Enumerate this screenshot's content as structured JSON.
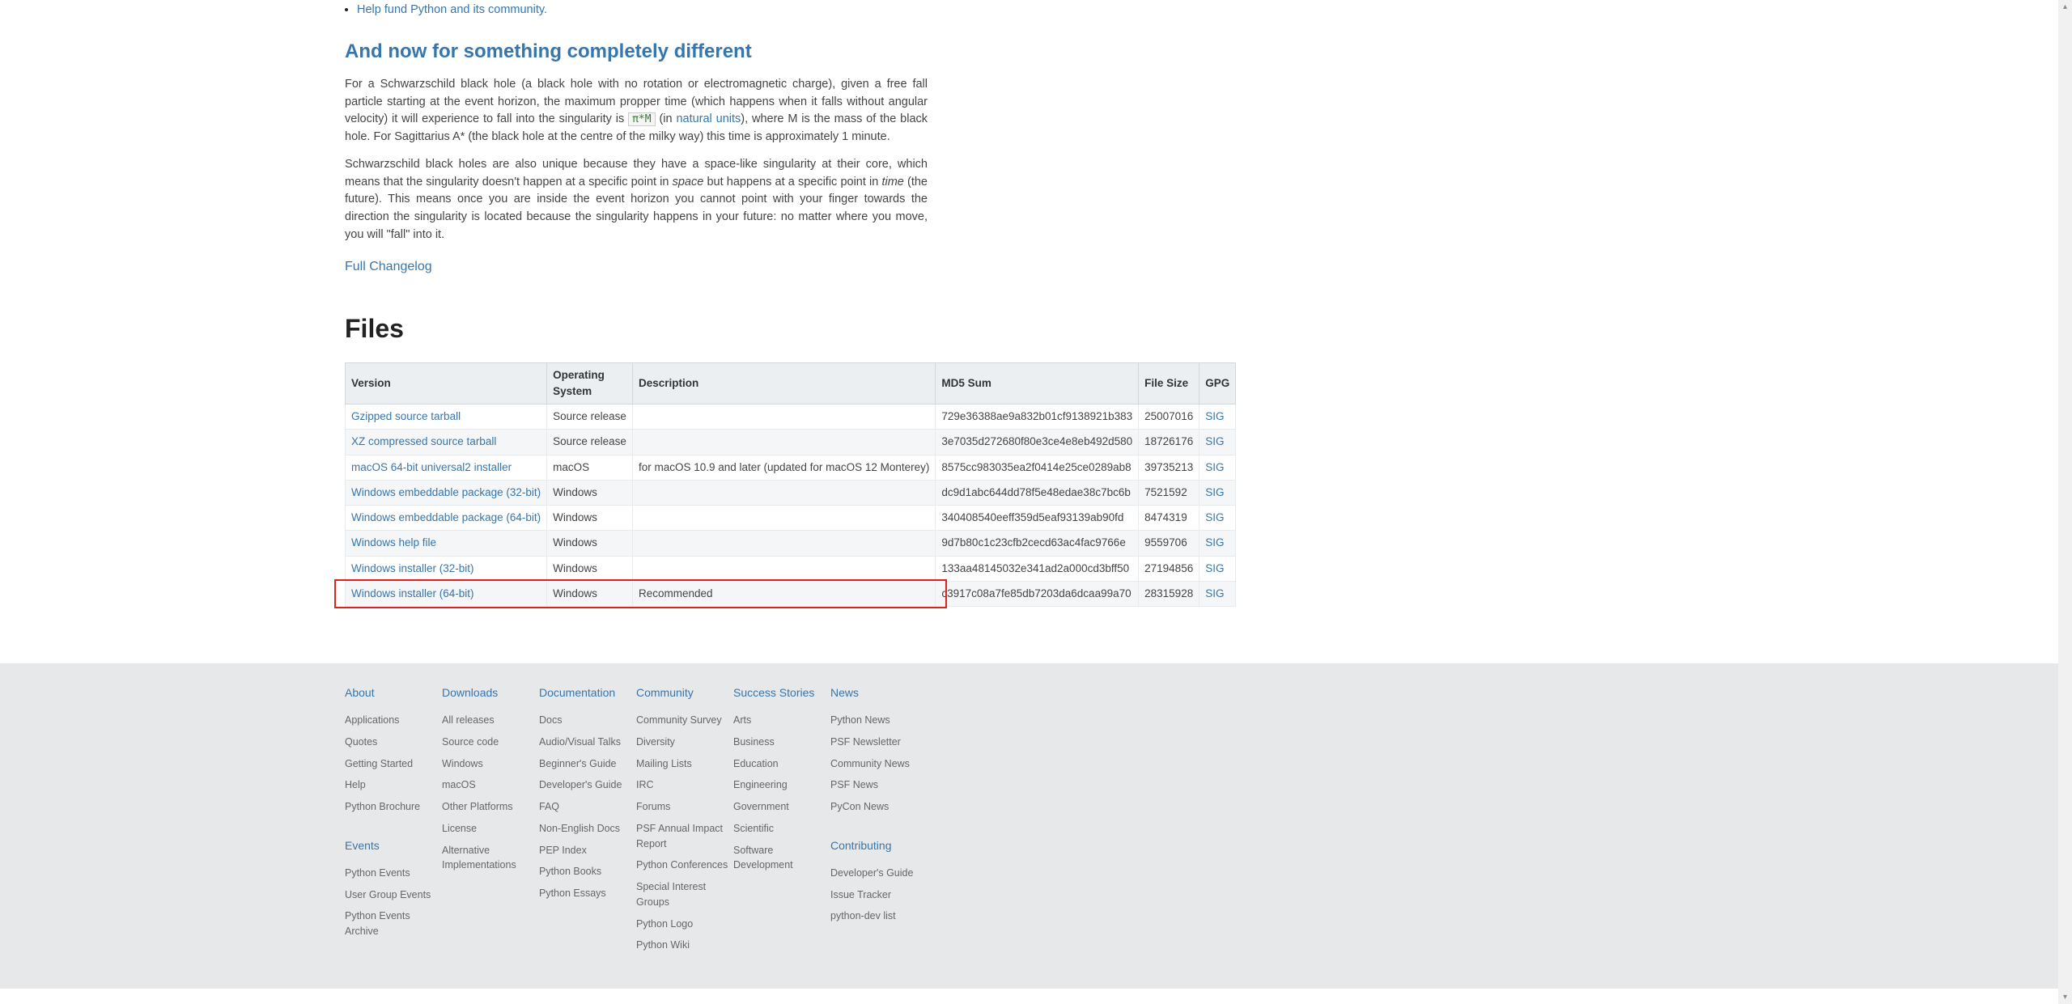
{
  "intro": {
    "bullet_link": "Help fund Python and its community."
  },
  "section": {
    "heading": "And now for something completely different",
    "p1_a": "For a Schwarzschild black hole (a black hole with no rotation or electromagnetic charge), given a free fall particle starting at the event horizon, the maximum propper time (which happens when it falls without angular velocity) it will experience to fall into the singularity is ",
    "code": "π*M",
    "p1_b": " (in ",
    "natural_units": "natural units",
    "p1_c": "), where M is the mass of the black hole. For Sagittarius A* (the black hole at the centre of the milky way) this time is approximately 1 minute.",
    "p2_a": "Schwarzschild black holes are also unique because they have a space-like singularity at their core, which means that the singularity doesn't happen at a specific point in ",
    "p2_space": "space",
    "p2_b": " but happens at a specific point in ",
    "p2_time": "time",
    "p2_c": " (the future). This means once you are inside the event horizon you cannot point with your finger towards the direction the singularity is located because the singularity happens in your future: no matter where you move, you will \"fall\" into it.",
    "full_changelog": "Full Changelog"
  },
  "files": {
    "heading": "Files",
    "headers": [
      "Version",
      "Operating System",
      "Description",
      "MD5 Sum",
      "File Size",
      "GPG"
    ],
    "rows": [
      {
        "version": "Gzipped source tarball",
        "os": "Source release",
        "desc": "",
        "md5": "729e36388ae9a832b01cf9138921b383",
        "size": "25007016",
        "gpg": "SIG"
      },
      {
        "version": "XZ compressed source tarball",
        "os": "Source release",
        "desc": "",
        "md5": "3e7035d272680f80e3ce4e8eb492d580",
        "size": "18726176",
        "gpg": "SIG"
      },
      {
        "version": "macOS 64-bit universal2 installer",
        "os": "macOS",
        "desc": "for macOS 10.9 and later (updated for macOS 12 Monterey)",
        "md5": "8575cc983035ea2f0414e25ce0289ab8",
        "size": "39735213",
        "gpg": "SIG"
      },
      {
        "version": "Windows embeddable package (32-bit)",
        "os": "Windows",
        "desc": "",
        "md5": "dc9d1abc644dd78f5e48edae38c7bc6b",
        "size": "7521592",
        "gpg": "SIG"
      },
      {
        "version": "Windows embeddable package (64-bit)",
        "os": "Windows",
        "desc": "",
        "md5": "340408540eeff359d5eaf93139ab90fd",
        "size": "8474319",
        "gpg": "SIG"
      },
      {
        "version": "Windows help file",
        "os": "Windows",
        "desc": "",
        "md5": "9d7b80c1c23cfb2cecd63ac4fac9766e",
        "size": "9559706",
        "gpg": "SIG"
      },
      {
        "version": "Windows installer (32-bit)",
        "os": "Windows",
        "desc": "",
        "md5": "133aa48145032e341ad2a000cd3bff50",
        "size": "27194856",
        "gpg": "SIG"
      },
      {
        "version": "Windows installer (64-bit)",
        "os": "Windows",
        "desc": "Recommended",
        "md5": "c3917c08a7fe85db7203da6dcaa99a70",
        "size": "28315928",
        "gpg": "SIG"
      }
    ],
    "highlight_index": 7
  },
  "footer": {
    "cols": [
      {
        "title": "About",
        "items": [
          "Applications",
          "Quotes",
          "Getting Started",
          "Help",
          "Python Brochure"
        ],
        "title2": "Events",
        "items2": [
          "Python Events",
          "User Group Events",
          "Python Events Archive"
        ]
      },
      {
        "title": "Downloads",
        "items": [
          "All releases",
          "Source code",
          "Windows",
          "macOS",
          "Other Platforms",
          "License",
          "Alternative Implementations"
        ]
      },
      {
        "title": "Documentation",
        "items": [
          "Docs",
          "Audio/Visual Talks",
          "Beginner's Guide",
          "Developer's Guide",
          "FAQ",
          "Non-English Docs",
          "PEP Index",
          "Python Books",
          "Python Essays"
        ]
      },
      {
        "title": "Community",
        "items": [
          "Community Survey",
          "Diversity",
          "Mailing Lists",
          "IRC",
          "Forums",
          "PSF Annual Impact Report",
          "Python Conferences",
          "Special Interest Groups",
          "Python Logo",
          "Python Wiki"
        ]
      },
      {
        "title": "Success Stories",
        "items": [
          "Arts",
          "Business",
          "Education",
          "Engineering",
          "Government",
          "Scientific",
          "Software Development"
        ]
      },
      {
        "title": "News",
        "items": [
          "Python News",
          "PSF Newsletter",
          "Community News",
          "PSF News",
          "PyCon News"
        ],
        "title2": "Contributing",
        "items2": [
          "Developer's Guide",
          "Issue Tracker",
          "python-dev list"
        ]
      }
    ]
  }
}
